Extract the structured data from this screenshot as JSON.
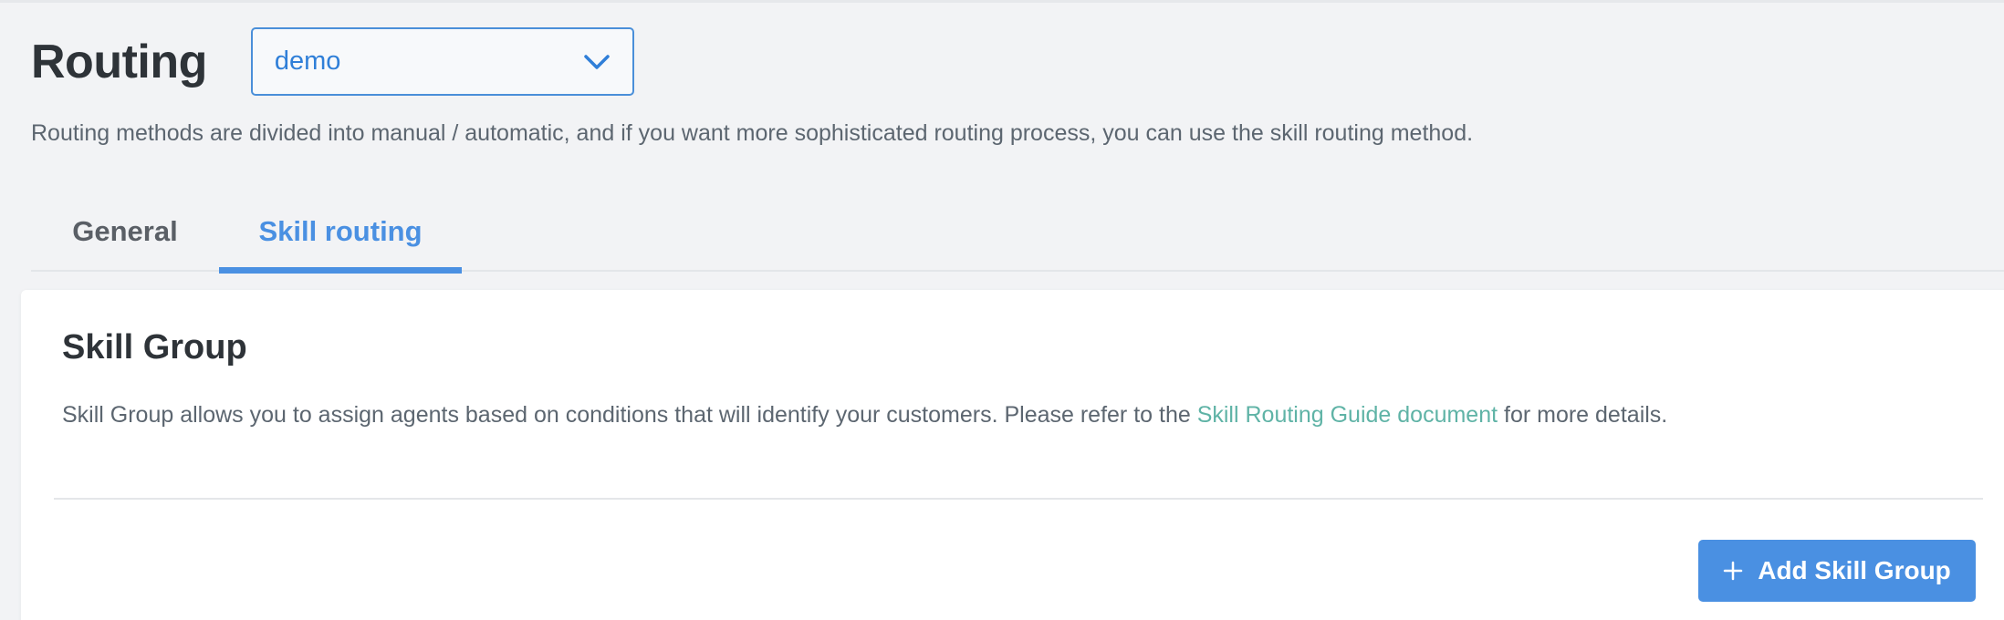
{
  "header": {
    "title": "Routing",
    "app_select": {
      "value": "demo"
    }
  },
  "description": "Routing methods are divided into manual / automatic, and if you want more sophisticated routing process, you can use the skill routing method.",
  "tabs": [
    {
      "label": "General",
      "active": false
    },
    {
      "label": "Skill routing",
      "active": true
    }
  ],
  "skill_group": {
    "title": "Skill Group",
    "desc_before": "Skill Group allows you to assign agents based on conditions that will identify your customers. Please refer to the ",
    "link_text": "Skill Routing Guide document",
    "desc_after": " for more details.",
    "add_button_label": "Add Skill Group"
  },
  "icons": {
    "select_arrow": "chevron-down-icon",
    "add": "plus-icon"
  },
  "colors": {
    "accent": "#4a90e2",
    "link": "#5fb3a6",
    "background": "#f2f3f5",
    "card": "#ffffff"
  }
}
